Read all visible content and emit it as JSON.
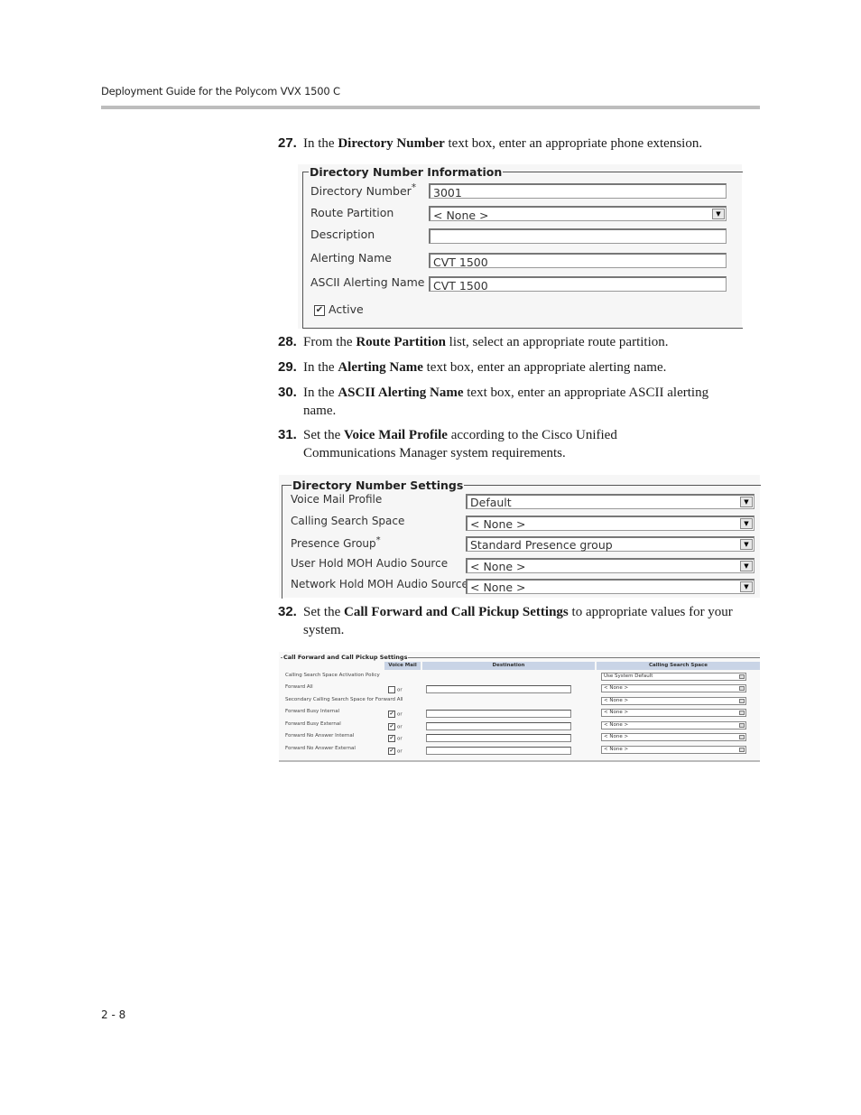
{
  "page": {
    "running_header": "Deployment Guide for the Polycom VVX 1500 C",
    "page_number": "2 - 8"
  },
  "steps": [
    {
      "num": "27.",
      "pre": "In the ",
      "bold": "Directory Number",
      "post": " text box, enter an appropriate phone extension."
    },
    {
      "num": "28.",
      "pre": "From the ",
      "bold": "Route Partition",
      "post": " list, select an appropriate route partition."
    },
    {
      "num": "29.",
      "pre": "In the ",
      "bold": "Alerting Name",
      "post": " text box, enter an appropriate alerting name."
    },
    {
      "num": "30.",
      "pre": "In the ",
      "bold": "ASCII Alerting Name",
      "post": " text box, enter an appropriate ASCII alerting name."
    },
    {
      "num": "31.",
      "pre": "Set the ",
      "bold": "Voice Mail Profile",
      "post": " according to the Cisco Unified Communications Manager system requirements."
    },
    {
      "num": "32.",
      "pre": "Set the ",
      "bold": "Call Forward and Call Pickup Settings",
      "post": " to appropriate values for your system."
    }
  ],
  "directory_number_information": {
    "legend": "Directory Number Information",
    "fields": [
      {
        "label": "Directory Number",
        "required": "*",
        "value": "3001",
        "type": "text"
      },
      {
        "label": "Route Partition",
        "value": "< None >",
        "type": "select"
      },
      {
        "label": "Description",
        "value": "",
        "type": "text"
      },
      {
        "label": "Alerting Name",
        "value": "CVT 1500",
        "type": "text"
      },
      {
        "label": "ASCII Alerting Name",
        "value": "CVT 1500",
        "type": "text"
      }
    ],
    "active": {
      "label": "Active",
      "checked": true,
      "check_glyph": "✔"
    }
  },
  "directory_number_settings": {
    "legend": "Directory Number Settings",
    "fields": [
      {
        "label": "Voice Mail Profile",
        "value": "Default"
      },
      {
        "label": "Calling Search Space",
        "value": "< None >"
      },
      {
        "label": "Presence Group",
        "required": "*",
        "value": "Standard Presence group"
      },
      {
        "label": "User Hold MOH Audio Source",
        "value": "< None >"
      },
      {
        "label": "Network Hold MOH Audio Source",
        "value": "< None >"
      }
    ]
  },
  "call_forward_settings": {
    "legend": "Call Forward and Call Pickup Settings",
    "columns": {
      "voice_mail": "Voice Mail",
      "destination": "Destination",
      "calling_search_space": "Calling Search Space"
    },
    "or_label": "or",
    "rows": [
      {
        "label": "Calling Search Space Activation Policy",
        "css": "Use System Default"
      },
      {
        "label": "Forward All",
        "voice_mail": false,
        "css": "< None >"
      },
      {
        "label": "Secondary Calling Search Space for Forward All",
        "css": "< None >"
      },
      {
        "label": "Forward Busy Internal",
        "voice_mail": true,
        "css": "< None >"
      },
      {
        "label": "Forward Busy External",
        "voice_mail": true,
        "css": "< None >"
      },
      {
        "label": "Forward No Answer Internal",
        "voice_mail": true,
        "css": "< None >"
      },
      {
        "label": "Forward No Answer External",
        "voice_mail": true,
        "css": "< None >"
      }
    ]
  },
  "icons": {
    "dropdown_arrow": "▼",
    "checkmark": "✔"
  }
}
